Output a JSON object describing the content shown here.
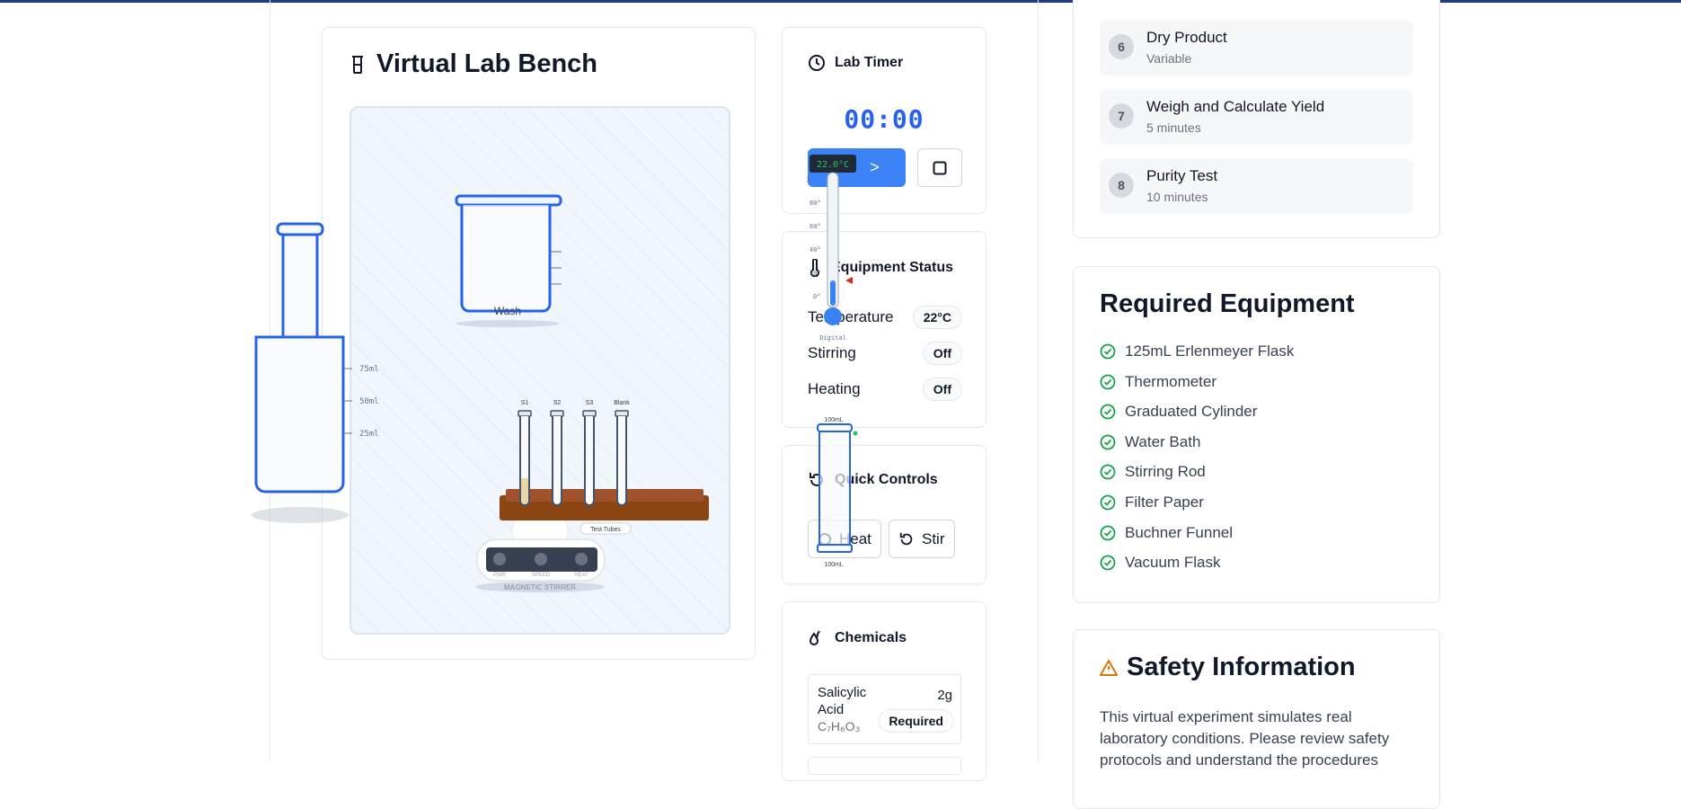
{
  "bench": {
    "title": "Virtual Lab Bench",
    "beaker_label": "Wash",
    "cylinder_marks": [
      "75ml",
      "50ml",
      "25ml"
    ],
    "tube_labels": [
      "S1",
      "S2",
      "S3",
      "Blank"
    ],
    "rack_label": "Test Tubes",
    "stirrer_knobs": [
      "PWR",
      "SPEED",
      "HEAT"
    ],
    "stirrer_label": "MAGNETIC STIRRER",
    "thermometer": {
      "reading": "22.0°C",
      "ticks": [
        "1",
        "80°",
        "60°",
        "40°",
        "20°",
        "0°"
      ],
      "type_label": "Digital"
    },
    "grad_cylinder": {
      "top_label": "100mL",
      "bottom_label": "100mL"
    }
  },
  "timer": {
    "title": "Lab Timer",
    "value": "00:00",
    "play_symbol": ">"
  },
  "equipment": {
    "title": "Equipment Status",
    "rows": [
      {
        "label": "Temperature",
        "value": "22°C"
      },
      {
        "label": "Stirring",
        "value": "Off"
      },
      {
        "label": "Heating",
        "value": "Off"
      }
    ]
  },
  "quick_controls": {
    "title": "Quick Controls",
    "heat_label": "Heat",
    "stir_label": "Stir"
  },
  "chemicals": {
    "title": "Chemicals",
    "items": [
      {
        "name_line1": "Salicylic",
        "name_line2": "Acid",
        "formula": "C₇H₆O₃",
        "amount": "2g",
        "badge": "Required"
      }
    ]
  },
  "steps": [
    {
      "num": "6",
      "title": "Dry Product",
      "duration": "Variable"
    },
    {
      "num": "7",
      "title": "Weigh and Calculate Yield",
      "duration": "5 minutes"
    },
    {
      "num": "8",
      "title": "Purity Test",
      "duration": "10 minutes"
    }
  ],
  "required_equipment": {
    "title": "Required Equipment",
    "items": [
      "125mL Erlenmeyer Flask",
      "Thermometer",
      "Graduated Cylinder",
      "Water Bath",
      "Stirring Rod",
      "Filter Paper",
      "Buchner Funnel",
      "Vacuum Flask"
    ]
  },
  "safety": {
    "title": "Safety Information",
    "text": "This virtual experiment simulates real laboratory conditions. Please review safety protocols and understand the procedures"
  },
  "colors": {
    "accent": "#3b82f6",
    "timer": "#2563eb",
    "check": "#16a34a",
    "warning": "#d97706",
    "glass": "#2563eb"
  }
}
